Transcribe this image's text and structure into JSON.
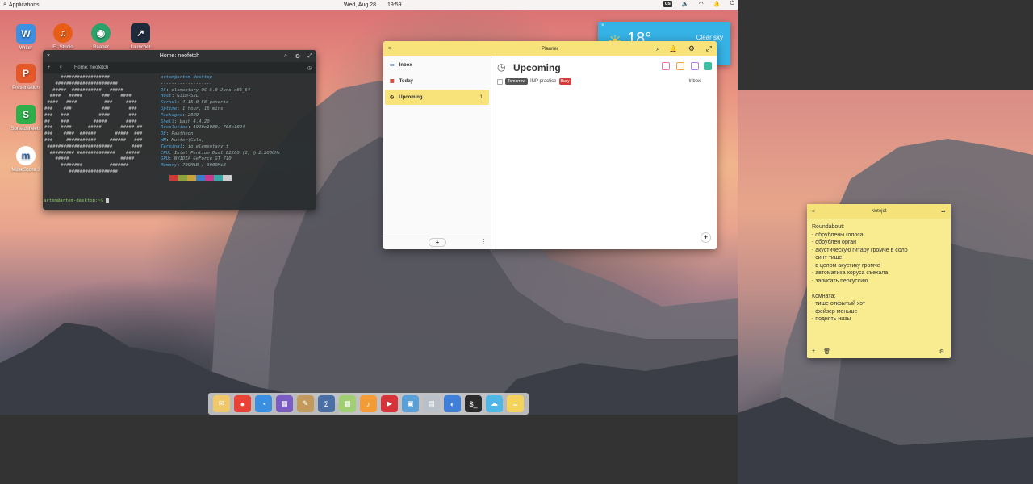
{
  "top_panel": {
    "applications_label": "Applications",
    "date": "Wed, Aug 28",
    "time": "19:59",
    "keyboard_layout": "us"
  },
  "desktop_icons": [
    {
      "label": "Writer",
      "color": "#3d8fe0",
      "glyph": "W"
    },
    {
      "label": "FL Studio",
      "color": "#e85d16",
      "glyph": "♫"
    },
    {
      "label": "Reaper",
      "color": "#2aa36b",
      "glyph": "◉"
    },
    {
      "label": "Launcher",
      "color": "#1f2a3a",
      "glyph": "↗"
    },
    {
      "label": "Presentation",
      "color": "#e5582a",
      "glyph": "P"
    },
    {
      "label": "Spreadsheets",
      "color": "#2fae4a",
      "glyph": "S"
    },
    {
      "label": "MuseScore 3",
      "color": "#ffffff",
      "glyph": "m"
    }
  ],
  "terminal": {
    "title": "Home: neofetch",
    "tab_label": "Home: neofetch",
    "header": "artem@artem-desktop",
    "separator": "-------------------",
    "info": [
      {
        "key": "OS",
        "value": "elementary OS 5.0 Juno x86_64"
      },
      {
        "key": "Host",
        "value": "G31M-S2L"
      },
      {
        "key": "Kernel",
        "value": "4.15.0-58-generic"
      },
      {
        "key": "Uptime",
        "value": "1 hour, 16 mins"
      },
      {
        "key": "Packages",
        "value": "2029"
      },
      {
        "key": "Shell",
        "value": "bash 4.4.20"
      },
      {
        "key": "Resolution",
        "value": "1920x1080, 768x1024"
      },
      {
        "key": "DE",
        "value": "Pantheon"
      },
      {
        "key": "WM",
        "value": "Mutter(Gala)"
      },
      {
        "key": "Terminal",
        "value": "io.elementary.t"
      },
      {
        "key": "CPU",
        "value": "Intel Pentium Dual E2200 (2) @ 2.200GHz"
      },
      {
        "key": "GPU",
        "value": "NVIDIA GeForce GT 710"
      },
      {
        "key": "Memory",
        "value": "709MiB / 3000MiB"
      }
    ],
    "prompt": "artem@artem-desktop:~$",
    "palette": [
      "#2d3436",
      "#cc3a3a",
      "#8aa43b",
      "#c9a23a",
      "#3a7ec9",
      "#c93a8f",
      "#3aa8a8",
      "#cccccc"
    ]
  },
  "planner": {
    "title": "Planner",
    "sidebar": [
      {
        "label": "Inbox",
        "count": ""
      },
      {
        "label": "Today",
        "count": ""
      },
      {
        "label": "Upcoming",
        "count": "1"
      }
    ],
    "heading": "Upcoming",
    "task": {
      "date_tag": "Tomorrow",
      "text": "INP practice",
      "label_tag": "Busy",
      "project": "Inbox"
    }
  },
  "weather": {
    "temp": "18°",
    "condition": "Clear sky"
  },
  "notejot": {
    "title": "Notejot",
    "lines": [
      "Roundabout:",
      "- обрублены голоса",
      "- обрублен орган",
      "- акустическую гитару громче в соло",
      "- синт тише",
      "- в целом акустику громче",
      "- автоматика хоруса съехала",
      "- записать перкуссию",
      "",
      "Комната:",
      "- тише открытый хэт",
      "- фейзер меньше",
      "- поднять низы"
    ]
  },
  "dock": {
    "items": [
      {
        "name": "mail",
        "color": "#f0c869",
        "glyph": "✉"
      },
      {
        "name": "chrome",
        "color": "#ea4335",
        "glyph": "●"
      },
      {
        "name": "epiphany",
        "color": "#3b8fe0",
        "glyph": "◔"
      },
      {
        "name": "appcenter",
        "color": "#7b5cc2",
        "glyph": "▦"
      },
      {
        "name": "brush",
        "color": "#c29a5c",
        "glyph": "✎"
      },
      {
        "name": "calc",
        "color": "#4a6fa5",
        "glyph": "Σ"
      },
      {
        "name": "spreadsheet",
        "color": "#9fcf72",
        "glyph": "▦"
      },
      {
        "name": "music",
        "color": "#f39c37",
        "glyph": "♪"
      },
      {
        "name": "videos",
        "color": "#d9333a",
        "glyph": "▶"
      },
      {
        "name": "photos",
        "color": "#5aa0d8",
        "glyph": "▣"
      },
      {
        "name": "files",
        "color": "#b9c0c8",
        "glyph": "▤"
      },
      {
        "name": "settings",
        "color": "#3f7fd8",
        "glyph": "◐"
      },
      {
        "name": "terminal",
        "color": "#2b2b2b",
        "glyph": "$_"
      },
      {
        "name": "weather",
        "color": "#4fb6e8",
        "glyph": "☁"
      },
      {
        "name": "notes",
        "color": "#f5d35a",
        "glyph": "≡"
      }
    ]
  }
}
